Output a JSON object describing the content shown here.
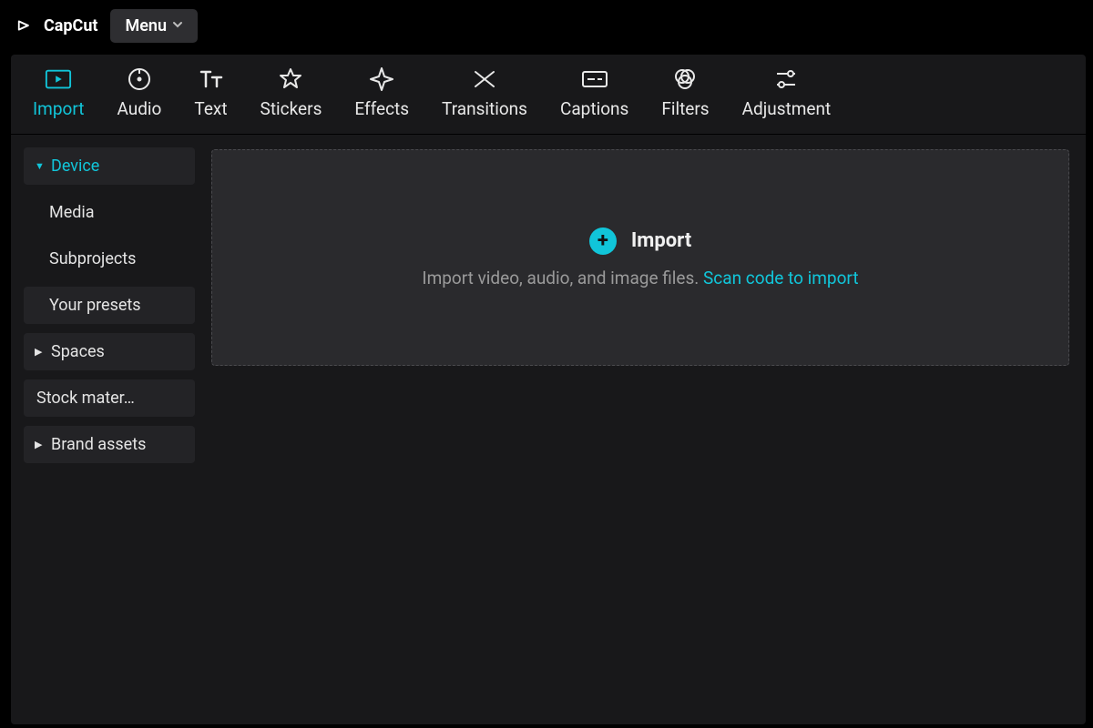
{
  "app": {
    "brand": "CapCut",
    "menu_label": "Menu"
  },
  "tabs": {
    "items": [
      {
        "label": "Import",
        "icon": "import-icon",
        "active": true
      },
      {
        "label": "Audio",
        "icon": "audio-icon",
        "active": false
      },
      {
        "label": "Text",
        "icon": "text-icon",
        "active": false
      },
      {
        "label": "Stickers",
        "icon": "stickers-icon",
        "active": false
      },
      {
        "label": "Effects",
        "icon": "effects-icon",
        "active": false
      },
      {
        "label": "Transitions",
        "icon": "transitions-icon",
        "active": false
      },
      {
        "label": "Captions",
        "icon": "captions-icon",
        "active": false
      },
      {
        "label": "Filters",
        "icon": "filters-icon",
        "active": false
      },
      {
        "label": "Adjustment",
        "icon": "adjustment-icon",
        "active": false
      }
    ]
  },
  "sidebar": {
    "groups": [
      {
        "label": "Device",
        "expanded": true,
        "active": true,
        "children": [
          {
            "label": "Media"
          },
          {
            "label": "Subprojects"
          },
          {
            "label": "Your presets"
          }
        ]
      },
      {
        "label": "Spaces",
        "expanded": false,
        "active": false,
        "children": []
      },
      {
        "label": "Stock mater…",
        "expanded": false,
        "active": false,
        "children": []
      },
      {
        "label": "Brand assets",
        "expanded": false,
        "active": false,
        "children": []
      }
    ]
  },
  "dropzone": {
    "title": "Import",
    "subtitle_prefix": "Import video, audio, and image files. ",
    "subtitle_link": "Scan code to import"
  },
  "colors": {
    "accent": "#11c5d9",
    "panel": "#18181a",
    "card": "#2a2a2d"
  }
}
